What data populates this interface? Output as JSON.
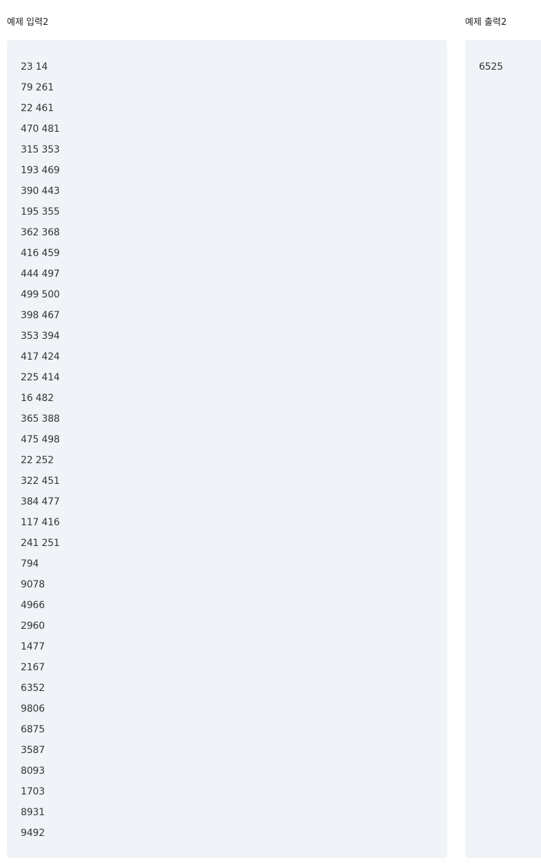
{
  "input_section": {
    "label": "예제 입력2",
    "lines": [
      "23 14",
      "79 261",
      "22 461",
      "470 481",
      "315 353",
      "193 469",
      "390 443",
      "195 355",
      "362 368",
      "416 459",
      "444 497",
      "499 500",
      "398 467",
      "353 394",
      "417 424",
      "225 414",
      "16 482",
      "365 388",
      "475 498",
      "22 252",
      "322 451",
      "384 477",
      "117 416",
      "241 251",
      "794",
      "9078",
      "4966",
      "2960",
      "1477",
      "2167",
      "6352",
      "9806",
      "6875",
      "3587",
      "8093",
      "1703",
      "8931",
      "9492"
    ]
  },
  "output_section": {
    "label": "예제 출력2",
    "lines": [
      "6525"
    ]
  }
}
